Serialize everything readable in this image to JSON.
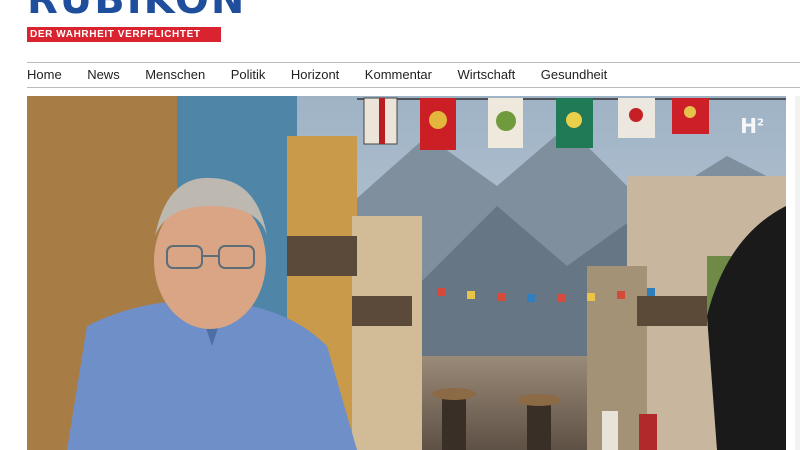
{
  "brand": {
    "logo_text": "RUBIKON",
    "tagline": "DER WAHRHEIT VERPFLICHTET",
    "accent": "#d9242f",
    "logo_color": "#1f4f9c"
  },
  "nav": {
    "items": [
      "Home",
      "News",
      "Menschen",
      "Politik",
      "Horizont",
      "Kommentar",
      "Wirtschaft",
      "Gesundheit"
    ]
  },
  "hero": {
    "watermark": "H",
    "watermark_sup": "2"
  }
}
